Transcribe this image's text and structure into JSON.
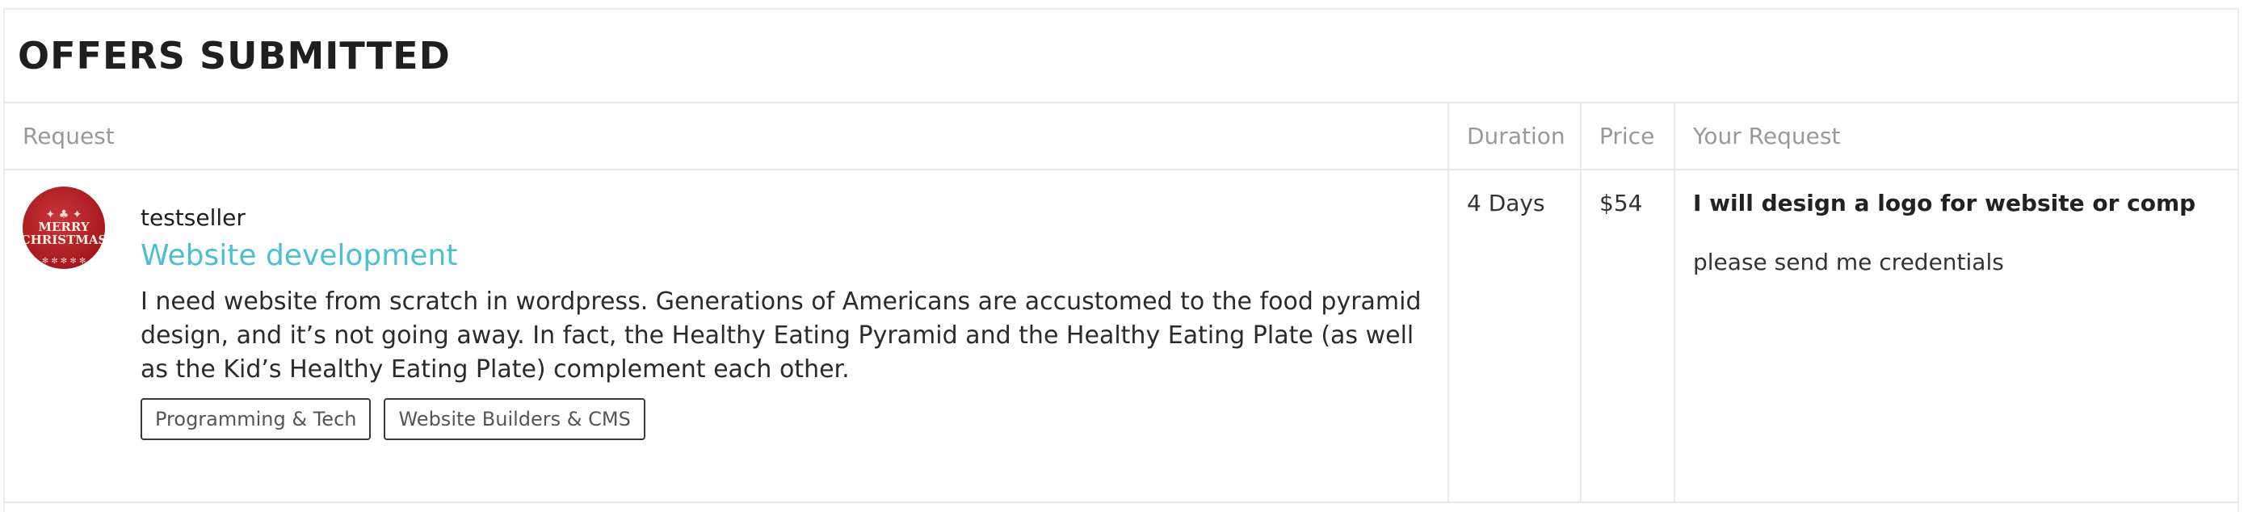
{
  "section": {
    "title": "OFFERS SUBMITTED"
  },
  "table": {
    "headers": [
      "Request",
      "Duration",
      "Price",
      "Your Request"
    ],
    "rows": [
      {
        "avatar": {
          "line1": "MERRY",
          "line2": "CHRISTMAS"
        },
        "username": "testseller",
        "title": "Website development",
        "description": "I need website from scratch in wordpress. Generations of Americans are accustomed to the food pyramid design, and it’s not going away. In fact, the Healthy Eating Pyramid and the Healthy Eating Plate (as well as the Kid’s Healthy Eating Plate) complement each other.",
        "tags": [
          "Programming & Tech",
          "Website Builders & CMS"
        ],
        "duration": "4 Days",
        "price": "$54",
        "your_request_title": "I will design a logo for website or comp",
        "your_request_message": "please send me credentials"
      }
    ]
  },
  "colors": {
    "accent": "#4cc0cf",
    "border": "#e8e8e8",
    "header_text": "#999999"
  }
}
